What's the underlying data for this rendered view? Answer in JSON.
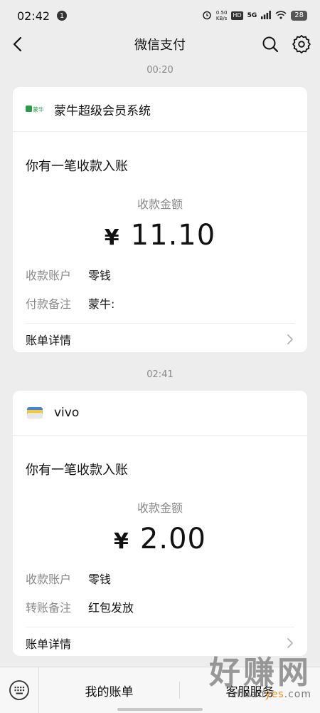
{
  "status_bar": {
    "time": "02:42",
    "notification_count": "1",
    "net_speed_value": "0.50",
    "net_speed_unit": "KB/s",
    "hd_badge": "HD",
    "network": "5G",
    "battery": "28"
  },
  "nav": {
    "title": "微信支付"
  },
  "messages": [
    {
      "timestamp": "00:20",
      "merchant": "蒙牛超级会员系统",
      "logo_text": "蒙牛",
      "headline": "你有一笔收款入账",
      "amount_label": "收款金额",
      "currency": "¥",
      "amount": "11.10",
      "details": [
        {
          "label": "收款账户",
          "value": "零钱"
        },
        {
          "label": "付款备注",
          "value": "蒙牛:"
        }
      ],
      "footer_link": "账单详情"
    },
    {
      "timestamp": "02:41",
      "merchant": "vivo",
      "headline": "你有一笔收款入账",
      "amount_label": "收款金额",
      "currency": "¥",
      "amount": "2.00",
      "details": [
        {
          "label": "收款账户",
          "value": "零钱"
        },
        {
          "label": "转账备注",
          "value": "红包发放"
        }
      ],
      "footer_link": "账单详情"
    }
  ],
  "bottom_menu": {
    "items": [
      "我的账单",
      "客服服务"
    ]
  },
  "watermark": {
    "main": "好赚网",
    "sub_prefix": "zhuan",
    "sub_accent": "yes",
    "sub_suffix": ".com"
  },
  "colors": {
    "background": "#ededed",
    "card": "#ffffff",
    "secondary_text": "#888888",
    "mengniu_green": "#2a9b49"
  }
}
